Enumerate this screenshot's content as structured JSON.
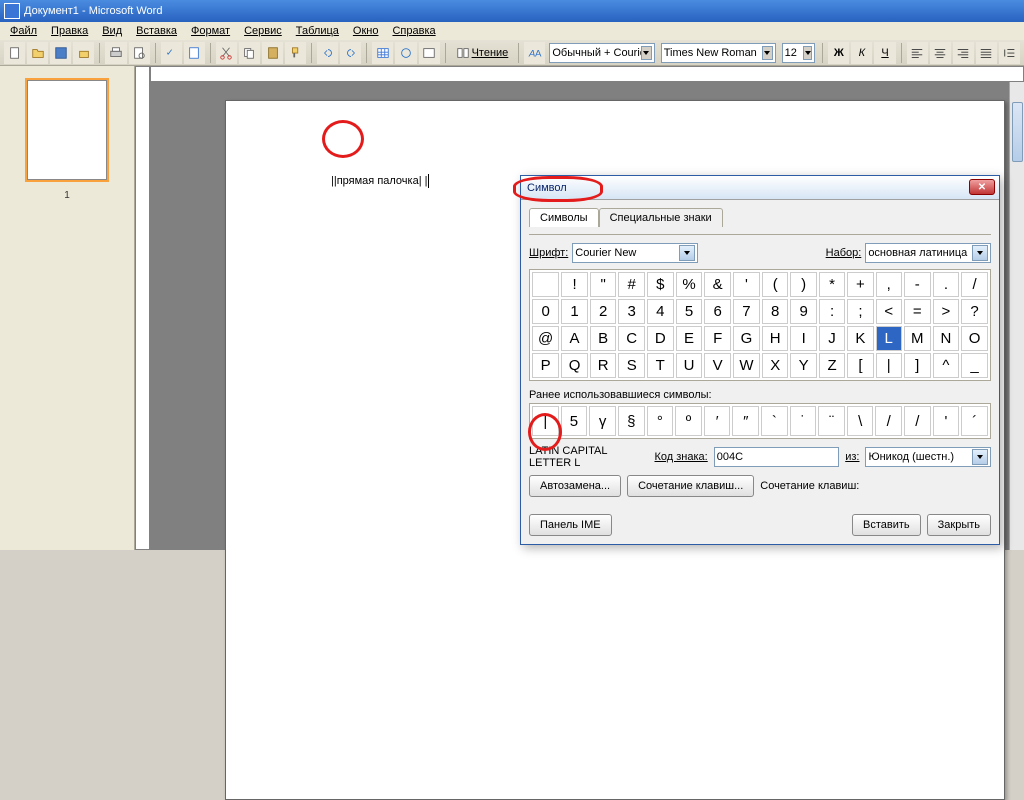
{
  "title": "Документ1 - Microsoft Word",
  "menu": [
    "Файл",
    "Правка",
    "Вид",
    "Вставка",
    "Формат",
    "Сервис",
    "Таблица",
    "Окно",
    "Справка"
  ],
  "toolbar": {
    "reading": "Чтение",
    "style": "Обычный + Courie",
    "font": "Times New Roman",
    "size": "12"
  },
  "document": {
    "text": "||прямая палочка| |",
    "page_number": "1"
  },
  "dialog": {
    "title": "Символ",
    "tabs": [
      "Символы",
      "Специальные знаки"
    ],
    "font_label": "Шрифт:",
    "font_value": "Courier New",
    "subset_label": "Набор:",
    "subset_value": "основная латиница",
    "rows": [
      [
        " ",
        "!",
        "\"",
        "#",
        "$",
        "%",
        "&",
        "'",
        "(",
        ")",
        "*",
        "+",
        ",",
        "-",
        ".",
        "/"
      ],
      [
        "0",
        "1",
        "2",
        "3",
        "4",
        "5",
        "6",
        "7",
        "8",
        "9",
        ":",
        ";",
        "<",
        "=",
        ">",
        "?"
      ],
      [
        "@",
        "A",
        "B",
        "C",
        "D",
        "E",
        "F",
        "G",
        "H",
        "I",
        "J",
        "K",
        "L",
        "M",
        "N",
        "O"
      ],
      [
        "P",
        "Q",
        "R",
        "S",
        "T",
        "U",
        "V",
        "W",
        "X",
        "Y",
        "Z",
        "[",
        "|",
        "]",
        "^",
        "_"
      ]
    ],
    "selected_index": [
      2,
      12
    ],
    "recent_label": "Ранее использовавшиеся символы:",
    "recent": [
      "|",
      "5",
      "γ",
      "§",
      "°",
      "º",
      "′",
      "″",
      "`",
      "˙",
      "¨",
      "\\",
      "/",
      "/",
      "'",
      "´"
    ],
    "char_name": "LATIN CAPITAL LETTER L",
    "code_label": "Код знака:",
    "code_value": "004C",
    "from_label": "из:",
    "from_value": "Юникод (шестн.)",
    "autocorrect": "Автозамена...",
    "shortcut": "Сочетание клавиш...",
    "shortcut_label": "Сочетание клавиш:",
    "ime": "Панель IME",
    "insert": "Вставить",
    "close": "Закрыть"
  }
}
